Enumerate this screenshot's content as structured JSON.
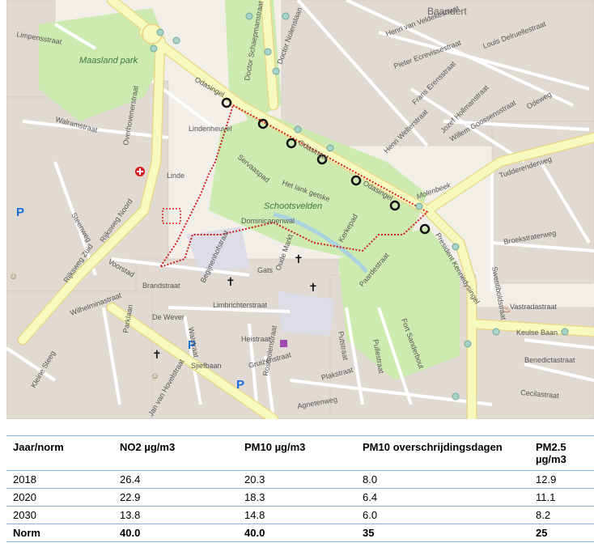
{
  "map": {
    "labels": {
      "park": "Maasland park",
      "baandert": "Baandert",
      "henri_van_velde": "Henri van Veldekestraat",
      "louis_delruelle": "Louis Delruellestraat",
      "pieter_ecrevisse": "Pieter Ecrevissestraat",
      "frans_erens": "Frans Erensstraat",
      "jozef_hollman": "Jozef Hollmanstraat",
      "willem_goossens": "Willem Goossensstraat",
      "henri_welter": "Henri Welterstraat",
      "tudderenderweg": "Tudderenderweg",
      "odasingel_1": "Odasingel",
      "odasingel_2": "Odasingel",
      "odasingel_3": "Odasingel",
      "doctor_nolens": "Doctor Nolenslaan",
      "doctor_schaepman": "Doctor Schaepmanstraat",
      "lindenheuvel": "Lindenheuvel",
      "walramstraat": "Walramstraat",
      "overhovenerstraat": "Overhovenerstraat",
      "rijksweg_noord": "Rijksweg Noord",
      "rijksweg_zuid": "Rijksweg Zuid",
      "steenweg": "Steenweg",
      "voorstad": "Voorstad",
      "wilhelminastraat": "Wilhelminastraat",
      "brandstraat": "Brandstraat",
      "limbrichterstraat": "Limbrichterstraat",
      "schootsvelden": "Schootsvelden",
      "dominicanenwal": "Dominicanenwal",
      "het_lank_getske": "Het lank getske",
      "servaaspad": "Servaaspad",
      "gats": "Gats",
      "oude_markt": "Oude Markt",
      "kerkepad": "Kerkepad",
      "paardestraat": "Paardestraat",
      "fort_sanderbout": "Fort Sanderbout",
      "putstraat": "Putstraat",
      "pullestraat": "Pullestraat",
      "gruizenstraat": "Gruizenstraat",
      "rosmolenstraat": "Rosmolenstraat",
      "plakstraat": "Plakstraat",
      "agnetenweg": "Agnetenweg",
      "president_kennedysingel": "President Kennedysingel",
      "keulse_baan": "Keulse Baan",
      "vastradastraat": "Vastradastraat",
      "benedictastraat": "Benedictastraat",
      "cecilastraat": "Cecilastraat",
      "broekstraterweg": "Broekstraterweg",
      "molenbeek": "Molenbeek",
      "walstraat": "Walstraat",
      "heistraat": "Heistraat",
      "sjiefbaan": "Sjiefbaan",
      "de_wever": "De Wever",
      "parklaan": "Parklaan",
      "kleine_steeg": "Kleine Steeg",
      "jan_van_hovelstraat": "Jan van Hovelstraat",
      "limpensstraat": "Limpensstraat",
      "linde": "Linde",
      "begijnenhofstraat": "Begijnenhofstraat",
      "swentiboldstraat": "Swentiboldstraat",
      "odeweg": "Odeweg"
    },
    "colors": {
      "background": "#f2efe9",
      "park": "#cdebb0",
      "main_road": "#f7fabf",
      "building": "#d9d0c9",
      "route": "#d22020",
      "water": "#aad3df"
    },
    "icons": [
      "hospital-icon",
      "parking-icon",
      "church-icon",
      "theatre-icon",
      "shop-icon",
      "fire-station-icon",
      "measurement-point-icon",
      "tree-icon"
    ]
  },
  "table": {
    "headers": [
      "Jaar/norm",
      "NO2 µg/m3",
      "PM10 µg/m3",
      "PM10 overschrijdingsdagen",
      "PM2.5 µg/m3"
    ],
    "rows": [
      [
        "2018",
        "26.4",
        "20.3",
        "8.0",
        "12.9"
      ],
      [
        "2020",
        "22.9",
        "18.3",
        "6.4",
        "11.1"
      ],
      [
        "2030",
        "13.8",
        "14.8",
        "6.0",
        "8.2"
      ]
    ],
    "norm_row": [
      "Norm",
      "40.0",
      "40.0",
      "35",
      "25"
    ]
  }
}
